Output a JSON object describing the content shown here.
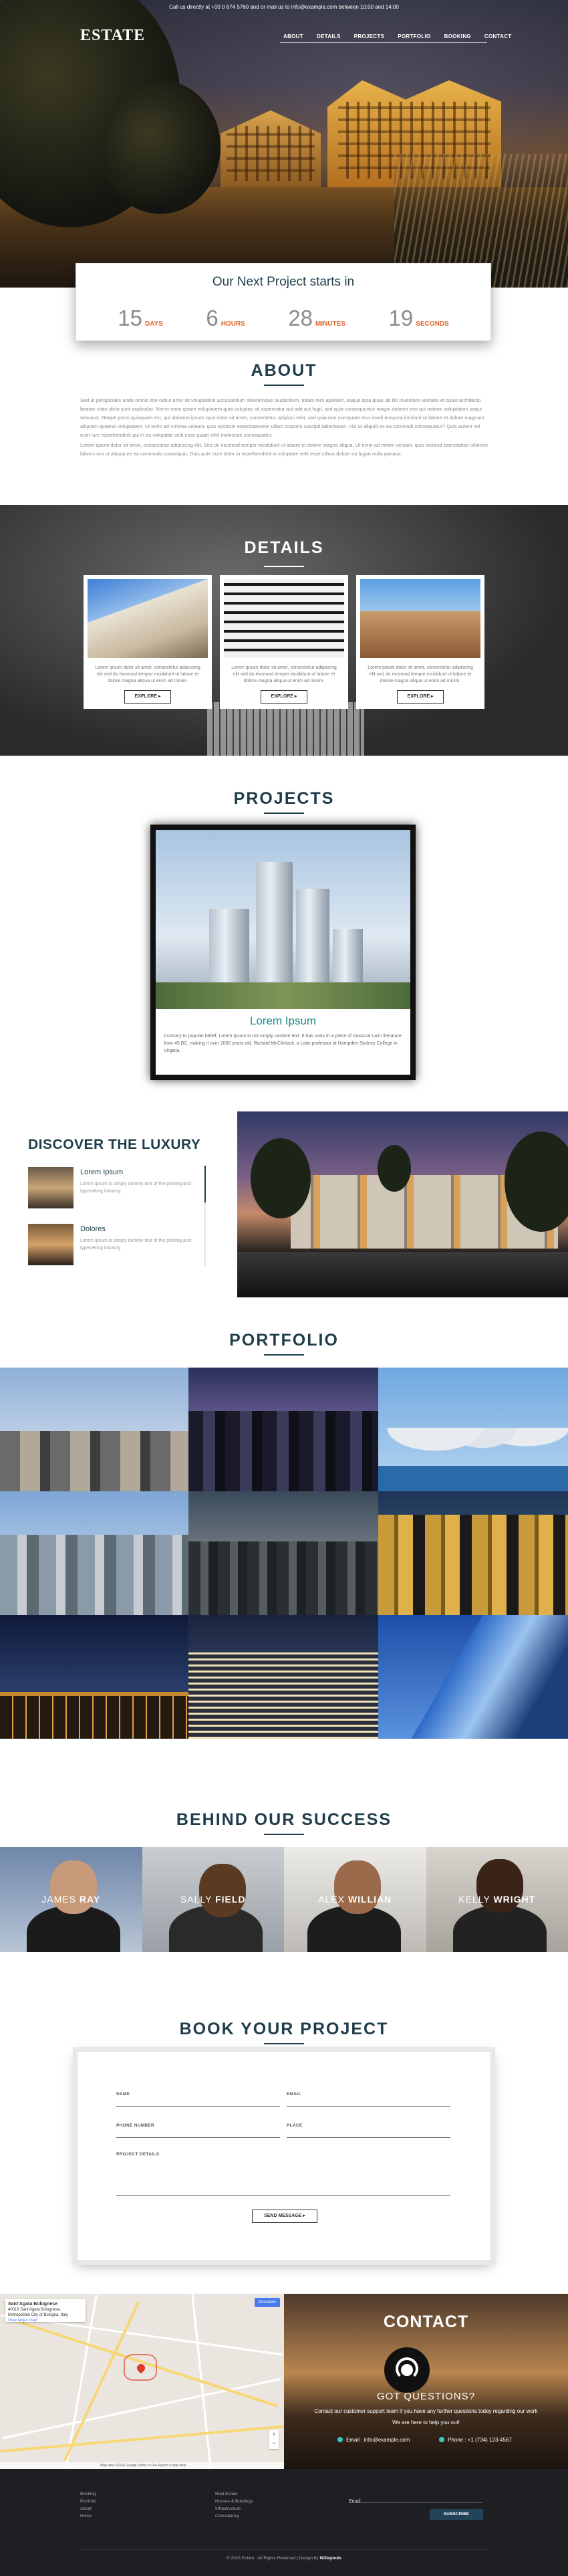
{
  "topbar": {
    "text": "Call us directly at +00 0 674 5760 and or mail us to info@example.com between 10:00 and 14:00"
  },
  "brand": {
    "logo": "ESTATE"
  },
  "nav": {
    "items": [
      "ABOUT",
      "DETAILS",
      "PROJECTS",
      "PORTFOLIO",
      "BOOKING",
      "CONTACT"
    ]
  },
  "countdown": {
    "title": "Our Next Project starts in",
    "units": [
      {
        "value": "15",
        "label": "DAYS"
      },
      {
        "value": "6",
        "label": "HOURS"
      },
      {
        "value": "28",
        "label": "MINUTES"
      },
      {
        "value": "19",
        "label": "SECONDS"
      }
    ],
    "accent": "#e0672e"
  },
  "about": {
    "title": "ABOUT",
    "paragraphs": [
      "Sed ut perspiciatis unde omnis iste natus error sit voluptatem accusantium doloremque laudantium, totam rem aperiam, eaque ipsa quae ab illo inventore veritatis et quasi architecto beatae vitae dicta sunt explicabo. Nemo enim ipsam voluptatem quia voluptas sit aspernatur aut odit aut fugit, sed quia consequuntur magni dolores eos qui ratione voluptatem sequi nesciunt. Neque porro quisquam est, qui dolorem ipsum quia dolor sit amet, consectetur, adipisci velit, sed quia non numquam eius modi tempora incidunt ut labore et dolore magnam aliquam quaerat voluptatem. Ut enim ad minima veniam, quis nostrum exercitationem ullam corporis suscipit laboriosam, nisi ut aliquid ex ea commodi consequatur? Quis autem vel eum iure reprehenderit qui in ea voluptate velit esse quam nihil molestiae consequatur.",
      "Lorem ipsum dolor sit amet, consectetur adipiscing elit. Sed do eiusmod tempor incididunt ut labore et dolore magna aliqua. Ut enim ad minim veniam, quis nostrud exercitation ullamco laboris nisi ut aliquip ex ea commodo consequat. Duis aute irure dolor in reprehenderit in voluptate velit esse cillum dolore eu fugiat nulla pariatur."
    ]
  },
  "details": {
    "title": "DETAILS",
    "cards": [
      {
        "text": "Lorem ipsum dolor sit amet, consectetur adipiscing elit sed do eiusmod tempor incididunt ut labore et dolore magna aliqua ut enim ad minim.",
        "button": "EXPLORE"
      },
      {
        "text": "Lorem ipsum dolor sit amet, consectetur adipiscing elit sed do eiusmod tempor incididunt ut labore et dolore magna aliqua ut enim ad minim.",
        "button": "EXPLORE"
      },
      {
        "text": "Lorem ipsum dolor sit amet, consectetur adipiscing elit sed do eiusmod tempor incididunt ut labore et dolore magna aliqua ut enim ad minim.",
        "button": "EXPLORE"
      }
    ]
  },
  "projects": {
    "title": "PROJECTS",
    "card_title": "Lorem Ipsum",
    "card_text": "Contrary to popular belief, Lorem Ipsum is not simply random text. It has roots in a piece of classical Latin literature from 45 BC, making it over 2000 years old. Richard McClintock, a Latin professor at Hampden-Sydney College in Virginia."
  },
  "luxury": {
    "title": "DISCOVER THE LUXURY",
    "items": [
      {
        "title": "Lorem Ipsum",
        "text": "Lorem Ipsum is simply dummy text of the printing and typesetting industry."
      },
      {
        "title": "Dolores",
        "text": "Lorem Ipsum is simply dummy text of the printing and typesetting industry."
      }
    ]
  },
  "portfolio": {
    "title": "PORTFOLIO"
  },
  "team": {
    "title": "BEHIND OUR SUCCESS",
    "members": [
      {
        "first": "JAMES",
        "last": "RAY"
      },
      {
        "first": "SALLY",
        "last": "FIELD"
      },
      {
        "first": "ALEX",
        "last": "WILLIAN"
      },
      {
        "first": "KELLY",
        "last": "WRIGHT"
      }
    ]
  },
  "booking": {
    "title": "BOOK YOUR PROJECT",
    "fields": {
      "name": "NAME",
      "email": "EMAIL",
      "phone": "PHONE NUMBER",
      "place": "PLACE",
      "details": "PROJECT DETAILS"
    },
    "button": "SEND MESSAGE"
  },
  "map": {
    "place_name": "Sant'Agata Bolognese",
    "address": "40019 Sant'Agata Bolognese, Metropolitan City of Bologna, Italy",
    "link": "View larger map",
    "button": "Directions",
    "zoom_in": "+",
    "zoom_out": "−",
    "footer": "Map data ©2016 Google  Terms of Use  Report a map error"
  },
  "contact": {
    "title": "CONTACT",
    "subtitle": "GOT QUESTIONS?",
    "line1": "Contact our customer support team if you have any further questions today regarding our work",
    "line2": "We are here to help you out!",
    "email": "Email : info@example.com",
    "phone": "Phone : +1 (734) 123-4567"
  },
  "footer": {
    "col1": [
      "Booking",
      "Portfolio",
      "About",
      "Home"
    ],
    "col2": [
      "Real Estate",
      "Houses & Buildings",
      "Infrastructure",
      "Consultancy"
    ],
    "email_label": "Email",
    "subscribe": "SUBSCRIBE",
    "copyright": "© 2016 Estate . All Rights Reserved | Design by ",
    "designer": "W3layouts"
  }
}
